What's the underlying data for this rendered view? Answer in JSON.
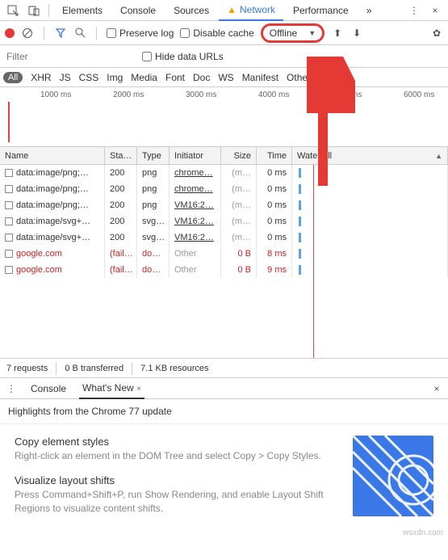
{
  "tabs": {
    "elements": "Elements",
    "console": "Console",
    "sources": "Sources",
    "network": "Network",
    "performance": "Performance",
    "more": "»"
  },
  "toolbar": {
    "preserve_log": "Preserve log",
    "disable_cache": "Disable cache",
    "throttle_value": "Offline"
  },
  "filter": {
    "placeholder": "Filter",
    "hide_urls": "Hide data URLs"
  },
  "types": {
    "all": "All",
    "xhr": "XHR",
    "js": "JS",
    "css": "CSS",
    "img": "Img",
    "media": "Media",
    "font": "Font",
    "doc": "Doc",
    "ws": "WS",
    "manifest": "Manifest",
    "other": "Other"
  },
  "timeline": {
    "t1": "1000 ms",
    "t2": "2000 ms",
    "t3": "3000 ms",
    "t4": "4000 ms",
    "t5": "5000 ms",
    "t6": "6000 ms"
  },
  "headers": {
    "name": "Name",
    "status": "Sta…",
    "type": "Type",
    "initiator": "Initiator",
    "size": "Size",
    "time": "Time",
    "waterfall": "Waterfall"
  },
  "rows": [
    {
      "name": "data:image/png;…",
      "status": "200",
      "type": "png",
      "init": "chrome…",
      "size": "(m…",
      "time": "0 ms",
      "fail": false,
      "itype": "png"
    },
    {
      "name": "data:image/png;…",
      "status": "200",
      "type": "png",
      "init": "chrome…",
      "size": "(m…",
      "time": "0 ms",
      "fail": false,
      "itype": "png"
    },
    {
      "name": "data:image/png;…",
      "status": "200",
      "type": "png",
      "init": "VM16:2…",
      "size": "(m…",
      "time": "0 ms",
      "fail": false,
      "itype": "png"
    },
    {
      "name": "data:image/svg+…",
      "status": "200",
      "type": "svg…",
      "init": "VM16:2…",
      "size": "(m…",
      "time": "0 ms",
      "fail": false,
      "itype": "svg"
    },
    {
      "name": "data:image/svg+…",
      "status": "200",
      "type": "svg…",
      "init": "VM16:2…",
      "size": "(m…",
      "time": "0 ms",
      "fail": false,
      "itype": "svg"
    },
    {
      "name": "google.com",
      "status": "(fail…",
      "type": "do…",
      "init": "Other",
      "size": "0 B",
      "time": "8 ms",
      "fail": true,
      "itype": "doc"
    },
    {
      "name": "google.com",
      "status": "(fail…",
      "type": "do…",
      "init": "Other",
      "size": "0 B",
      "time": "9 ms",
      "fail": true,
      "itype": "doc"
    }
  ],
  "status": {
    "requests": "7 requests",
    "transferred": "0 B transferred",
    "resources": "7.1 KB resources"
  },
  "drawer": {
    "console": "Console",
    "whatsnew": "What's New",
    "close_x": "×",
    "highlights": "Highlights from the Chrome 77 update",
    "tip1_title": "Copy element styles",
    "tip1_body": "Right-click an element in the DOM Tree and select Copy > Copy Styles.",
    "tip2_title": "Visualize layout shifts",
    "tip2_body": "Press Command+Shift+P, run Show Rendering, and enable Layout Shift Regions to visualize content shifts."
  },
  "watermark": "wsxdn.com"
}
